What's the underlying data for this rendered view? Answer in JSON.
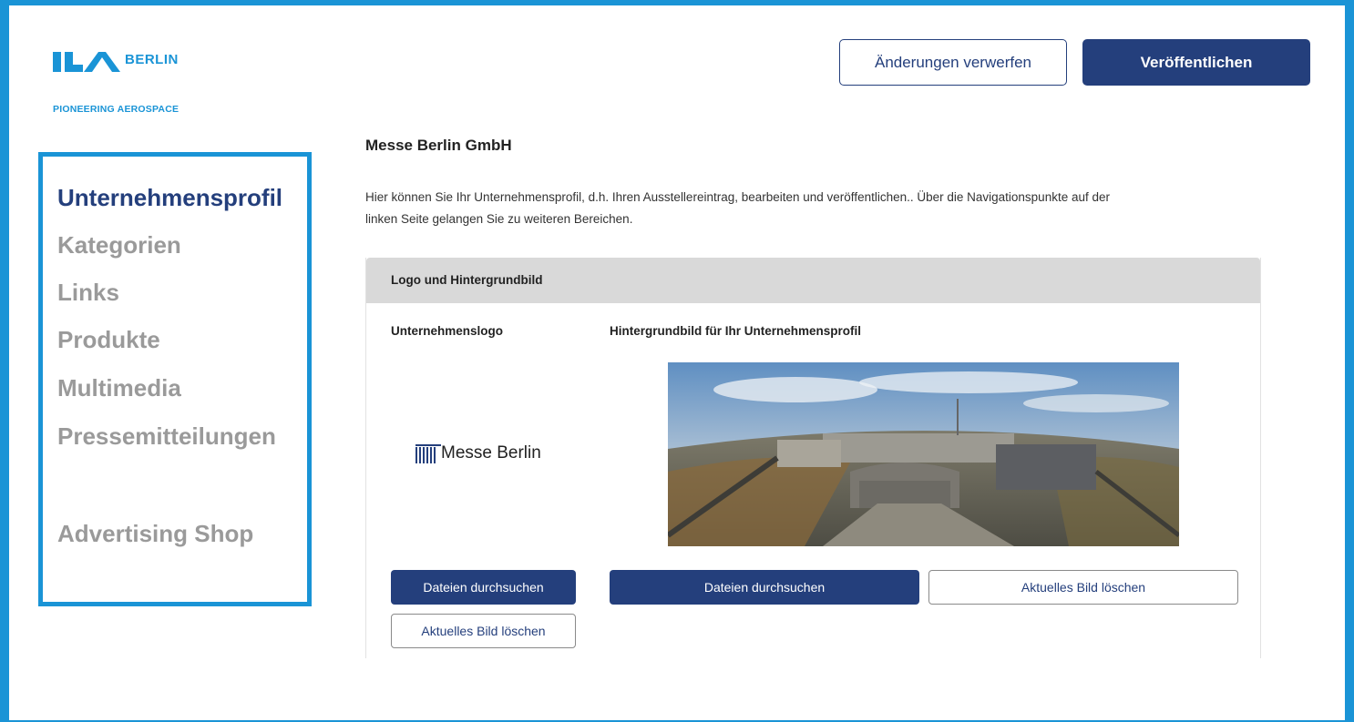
{
  "colors": {
    "brand_blue": "#1a94d6",
    "navy": "#243f7c",
    "muted_nav": "#9a9a9a",
    "panel_header": "#d9d9d9"
  },
  "brand": {
    "wordmark": "ILA",
    "city": "BERLIN",
    "tagline": "PIONEERING AEROSPACE"
  },
  "header": {
    "discard_label": "Änderungen verwerfen",
    "publish_label": "Veröffentlichen"
  },
  "sidebar": {
    "items": [
      {
        "label": "Unternehmensprofil",
        "active": true
      },
      {
        "label": "Kategorien",
        "active": false
      },
      {
        "label": "Links",
        "active": false
      },
      {
        "label": "Produkte",
        "active": false
      },
      {
        "label": "Multimedia",
        "active": false
      },
      {
        "label": "Pressemitteilungen",
        "active": false
      },
      {
        "label": "Advertising Shop",
        "active": false
      }
    ]
  },
  "main": {
    "company_name": "Messe Berlin GmbH",
    "intro_line1": "Hier können Sie Ihr Unternehmensprofil, d.h. Ihren Ausstellereintrag, bearbeiten und veröffentlichen.. Über die Navigationspunkte auf der",
    "intro_line2": "linken Seite gelangen Sie zu weiteren Bereichen.",
    "panel": {
      "title": "Logo und Hintergrundbild",
      "logo_label": "Unternehmenslogo",
      "background_label": "Hintergrundbild für Ihr Unternehmensprofil",
      "logo_text": "Messe Berlin",
      "logo_browse": "Dateien durchsuchen",
      "logo_delete": "Aktuelles Bild löschen",
      "bg_browse": "Dateien durchsuchen",
      "bg_delete": "Aktuelles Bild löschen"
    }
  }
}
